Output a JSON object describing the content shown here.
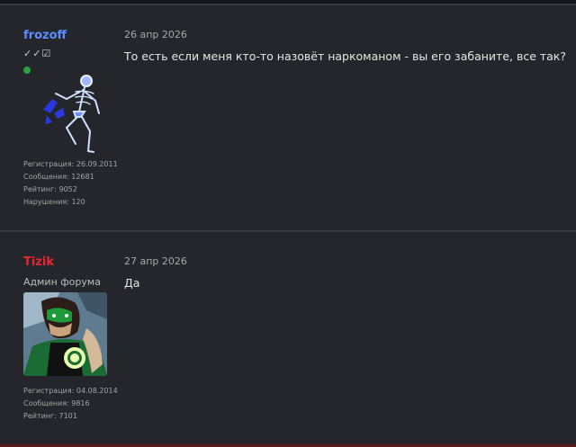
{
  "posts": [
    {
      "author": {
        "name": "frozoff",
        "name_color": "#5b8dff",
        "marks": "✓✓☑",
        "online": true,
        "avatar_icon": "skeleton-avatar",
        "stats": [
          "Регистрация: 26.09.2011",
          "Сообщения: 12681",
          "Рейтинг: 9052",
          "Нарушения: 120"
        ]
      },
      "date": "26 апр 2026",
      "message": "То есть если меня кто-то назовёт наркоманом - вы его забаните, все так?"
    },
    {
      "author": {
        "name": "Tizik",
        "name_color": "#e8262f",
        "role": "Админ форума",
        "avatar_icon": "green-lantern-avatar",
        "stats": [
          "Регистрация: 04.08.2014",
          "Сообщения: 9816",
          "Рейтинг: 7101"
        ]
      },
      "date": "27 апр 2026",
      "message": "Да"
    }
  ]
}
